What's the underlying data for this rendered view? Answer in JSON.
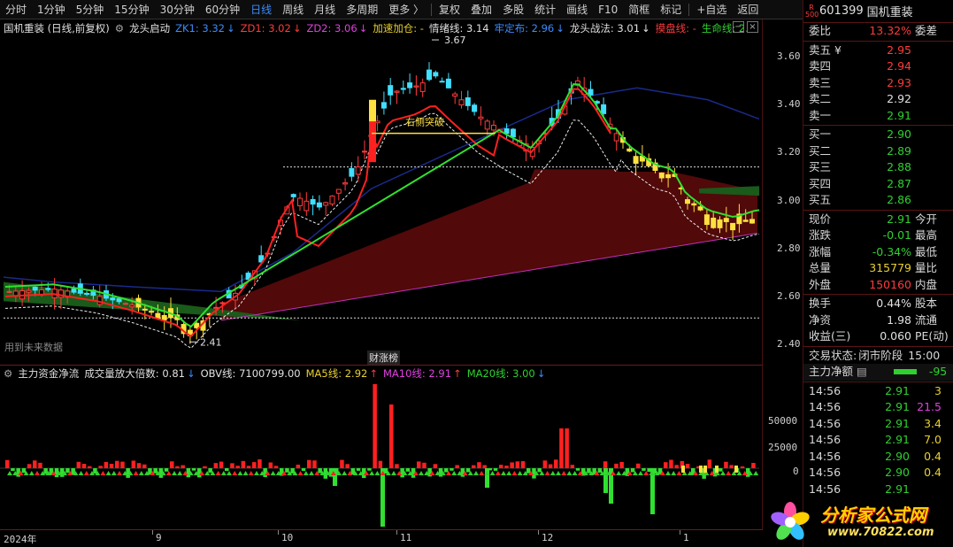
{
  "toolbar": {
    "items": [
      "分时",
      "1分钟",
      "5分钟",
      "15分钟",
      "30分钟",
      "60分钟",
      "日线",
      "周线",
      "月线",
      "多周期",
      "更多 〉",
      "复权",
      "叠加",
      "多股",
      "统计",
      "画线",
      "F10",
      "简框",
      "标记",
      "+自选",
      "返回"
    ],
    "active_index": 6
  },
  "main_chart": {
    "indicator_title": "国机重装 (日线,前复权)",
    "indicator_name": "龙头启动",
    "params": [
      {
        "label": "ZK1: 3.32",
        "color": "#3a8cff",
        "arrow": "↓"
      },
      {
        "label": "ZD1: 3.02",
        "color": "#ff3b3b",
        "arrow": "↓"
      },
      {
        "label": "ZD2: 3.06",
        "color": "#e040e0",
        "arrow": "↓"
      },
      {
        "label": "加速加仓: -",
        "color": "#e8d030",
        "arrow": ""
      },
      {
        "label": "情绪线: 3.14",
        "color": "#e0e0e0",
        "arrow": ""
      },
      {
        "label": "牢定布: 2.96",
        "color": "#3a8cff",
        "arrow": "↓"
      },
      {
        "label": "龙头战法: 3.01",
        "color": "#e0e0e0",
        "arrow": "↓"
      },
      {
        "label": "摸盘线: -",
        "color": "#ff3b3b",
        "arrow": ""
      },
      {
        "label": "生命线: 2.",
        "color": "#30d030",
        "arrow": ""
      }
    ],
    "y_ticks": [
      "3.60",
      "3.40",
      "3.20",
      "3.00",
      "2.80",
      "2.60",
      "2.40"
    ],
    "high_label": "3.67",
    "low_label": "2.41",
    "breakout_label": "右侧突破",
    "future_label": "用到未来数据",
    "event_label": "财涨榜"
  },
  "sub_chart": {
    "title": "主力资金净流",
    "params": [
      {
        "label": "成交量放大倍数: 0.81",
        "color": "#e0e0e0",
        "arrow": "↓"
      },
      {
        "label": "OBV线: 7100799.00",
        "color": "#e0e0e0",
        "arrow": ""
      },
      {
        "label": "MA5线: 2.92",
        "color": "#e8d030",
        "arrow": "↑"
      },
      {
        "label": "MA10线: 2.91",
        "color": "#e040e0",
        "arrow": "↑"
      },
      {
        "label": "MA20线: 3.00",
        "color": "#30d030",
        "arrow": "↓"
      }
    ],
    "y_ticks": [
      "50000",
      "25000",
      "0"
    ]
  },
  "x_axis": [
    "2024年",
    "9",
    "10",
    "11",
    "12",
    "1"
  ],
  "quote": {
    "badge": "R 500",
    "code": "601399",
    "name": "国机重装",
    "weibi": {
      "label": "委比",
      "value": "13.32%",
      "label2": "委差"
    },
    "asks": [
      {
        "label": "卖五 ¥",
        "price": "2.95",
        "color": "red"
      },
      {
        "label": "卖四",
        "price": "2.94",
        "color": "red"
      },
      {
        "label": "卖三",
        "price": "2.93",
        "color": "red"
      },
      {
        "label": "卖二",
        "price": "2.92",
        "color": "white"
      },
      {
        "label": "卖一",
        "price": "2.91",
        "color": "green"
      }
    ],
    "bids": [
      {
        "label": "买一",
        "price": "2.90",
        "color": "green"
      },
      {
        "label": "买二",
        "price": "2.89",
        "color": "green"
      },
      {
        "label": "买三",
        "price": "2.88",
        "color": "green"
      },
      {
        "label": "买四",
        "price": "2.87",
        "color": "green"
      },
      {
        "label": "买五",
        "price": "2.86",
        "color": "green"
      }
    ],
    "stats": [
      {
        "k": "现价",
        "v": "2.91",
        "c": "green",
        "k2": "今开"
      },
      {
        "k": "涨跌",
        "v": "-0.01",
        "c": "green",
        "k2": "最高"
      },
      {
        "k": "涨幅",
        "v": "-0.34%",
        "c": "green",
        "k2": "最低"
      },
      {
        "k": "总量",
        "v": "315779",
        "c": "yellow",
        "k2": "量比"
      },
      {
        "k": "外盘",
        "v": "150160",
        "c": "red",
        "k2": "内盘"
      }
    ],
    "stats2": [
      {
        "k": "换手",
        "v": "0.44%",
        "c": "white",
        "k2": "股本"
      },
      {
        "k": "净资",
        "v": "1.98",
        "c": "white",
        "k2": "流通"
      },
      {
        "k": "收益(三)",
        "v": "0.060",
        "c": "white",
        "k2": "PE(动)"
      }
    ],
    "status_label": "交易状态:",
    "status_value": "闭市阶段",
    "status_time": "15:00",
    "main_net_label": "主力净额",
    "main_net_value": "-95",
    "ticks": [
      {
        "t": "14:56",
        "p": "2.91",
        "pc": "green",
        "v": "3",
        "vc": "yellow"
      },
      {
        "t": "14:56",
        "p": "2.91",
        "pc": "green",
        "v": "21.5",
        "vc": "mag"
      },
      {
        "t": "14:56",
        "p": "2.91",
        "pc": "green",
        "v": "3.4",
        "vc": "yellow"
      },
      {
        "t": "14:56",
        "p": "2.91",
        "pc": "green",
        "v": "7.0",
        "vc": "yellow"
      },
      {
        "t": "14:56",
        "p": "2.90",
        "pc": "green",
        "v": "0.4",
        "vc": "yellow"
      },
      {
        "t": "14:56",
        "p": "2.90",
        "pc": "green",
        "v": "0.4",
        "vc": "yellow"
      },
      {
        "t": "14:56",
        "p": "2.91",
        "pc": "green",
        "v": "",
        "vc": "yellow"
      }
    ]
  },
  "watermark": {
    "title": "分析家公式网",
    "url": "www.70822.com"
  }
}
